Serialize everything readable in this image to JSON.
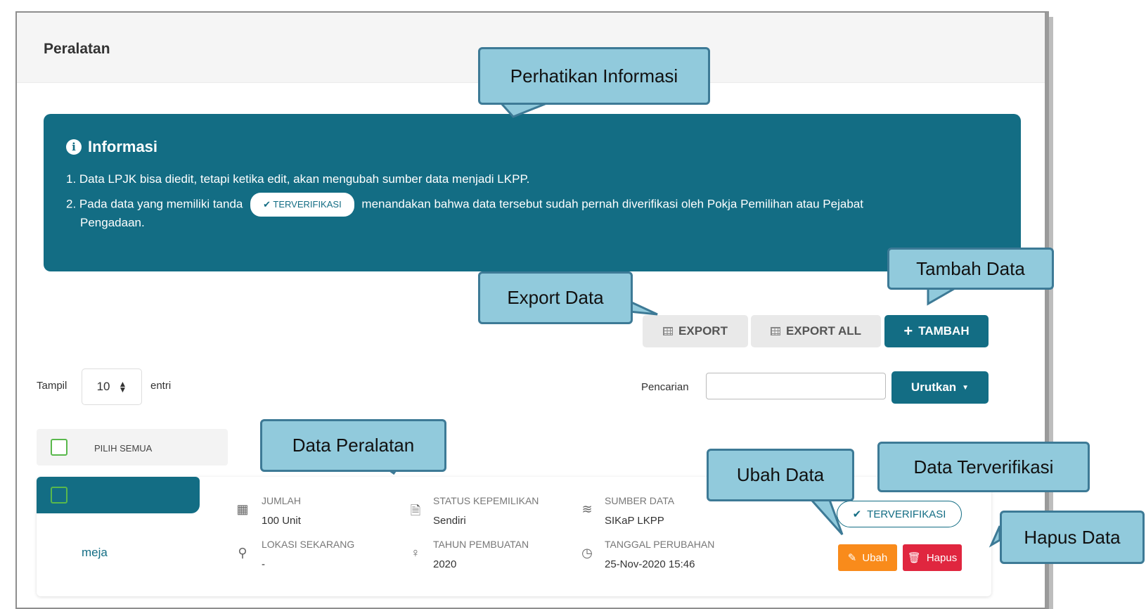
{
  "page": {
    "title": "Peralatan"
  },
  "info": {
    "heading": "Informasi",
    "line1": "1. Data LPJK bisa diedit, tetapi ketika edit, akan mengubah sumber data menjadi LKPP.",
    "line2_before": "2. Pada data yang memiliki tanda",
    "line2_badge": "TERVERIFIKASI",
    "line2_after": "menandakan bahwa data tersebut sudah pernah diverifikasi oleh Pokja Pemilihan atau Pejabat",
    "line3": "Pengadaan."
  },
  "toolbar": {
    "export_label": "EXPORT",
    "export_all_label": "EXPORT ALL",
    "tambah_label": "TAMBAH"
  },
  "filters": {
    "tampil_label": "Tampil",
    "page_size": "10",
    "entri_label": "entri",
    "pencarian_label": "Pencarian",
    "search_value": "",
    "urutkan_label": "Urutkan"
  },
  "list": {
    "select_all_label": "PILIH SEMUA",
    "items": [
      {
        "name": "meja",
        "jumlah_label": "JUMLAH",
        "jumlah_value": "100 Unit",
        "lokasi_label": "LOKASI SEKARANG",
        "lokasi_value": "-",
        "status_label": "STATUS KEPEMILIKAN",
        "status_value": "Sendiri",
        "tahun_label": "TAHUN PEMBUATAN",
        "tahun_value": "2020",
        "sumber_label": "SUMBER DATA",
        "sumber_value": "SIKaP LKPP",
        "tanggal_label": "TANGGAL PERUBAHAN",
        "tanggal_value": "25-Nov-2020 15:46",
        "verified_label": "TERVERIFIKASI",
        "ubah_label": "Ubah",
        "hapus_label": "Hapus"
      }
    ]
  },
  "callouts": {
    "perhatikan": "Perhatikan Informasi",
    "tambah": "Tambah Data",
    "export": "Export Data",
    "data_peralatan": "Data Peralatan",
    "ubah": "Ubah Data",
    "terverifikasi": "Data Terverifikasi",
    "hapus": "Hapus Data"
  },
  "colors": {
    "primary": "#136d84",
    "ubah": "#f98b1b",
    "hapus": "#e0263f",
    "callout_fill": "#91cadc",
    "callout_border": "#3d7a96"
  },
  "icons": [
    "info-icon",
    "table-icon",
    "plus-icon",
    "sort-caret-icon",
    "grid-icon",
    "map-pin-icon",
    "document-icon",
    "lightbulb-icon",
    "database-icon",
    "clock-icon",
    "check-icon",
    "edit-icon",
    "trash-icon"
  ]
}
